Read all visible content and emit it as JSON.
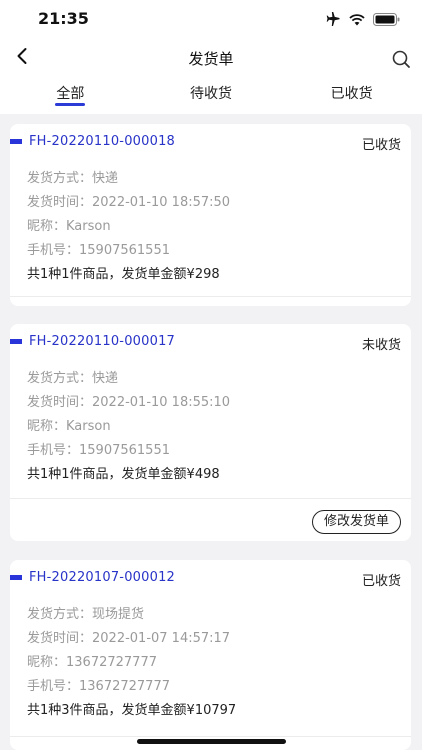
{
  "status_bar": {
    "time": "21:35"
  },
  "header": {
    "title": "发货单"
  },
  "tabs": [
    {
      "label": "全部",
      "active": true
    },
    {
      "label": "待收货",
      "active": false
    },
    {
      "label": "已收货",
      "active": false
    }
  ],
  "orders": [
    {
      "order_no": "FH-20220110-000018",
      "status": "已收货",
      "shipping_method": "发货方式：快递",
      "shipping_time": "发货时间：2022-01-10 18:57:50",
      "nickname": "昵称：Karson",
      "phone": "手机号：15907561551",
      "summary": "共1种1件商品，发货单金额¥298"
    },
    {
      "order_no": "FH-20220110-000017",
      "status": "未收货",
      "shipping_method": "发货方式：快递",
      "shipping_time": "发货时间：2022-01-10 18:55:10",
      "nickname": "昵称：Karson",
      "phone": "手机号：15907561551",
      "summary": "共1种1件商品，发货单金额¥498",
      "action_label": "修改发货单"
    },
    {
      "order_no": "FH-20220107-000012",
      "status": "已收货",
      "shipping_method": "发货方式：现场提货",
      "shipping_time": "发货时间：2022-01-07 14:57:17",
      "nickname": "昵称：13672727777",
      "phone": "手机号：13672727777",
      "summary": "共1种3件商品，发货单金额¥10797"
    }
  ],
  "colors": {
    "accent": "#2a35d9",
    "background": "#f2f2f4"
  }
}
